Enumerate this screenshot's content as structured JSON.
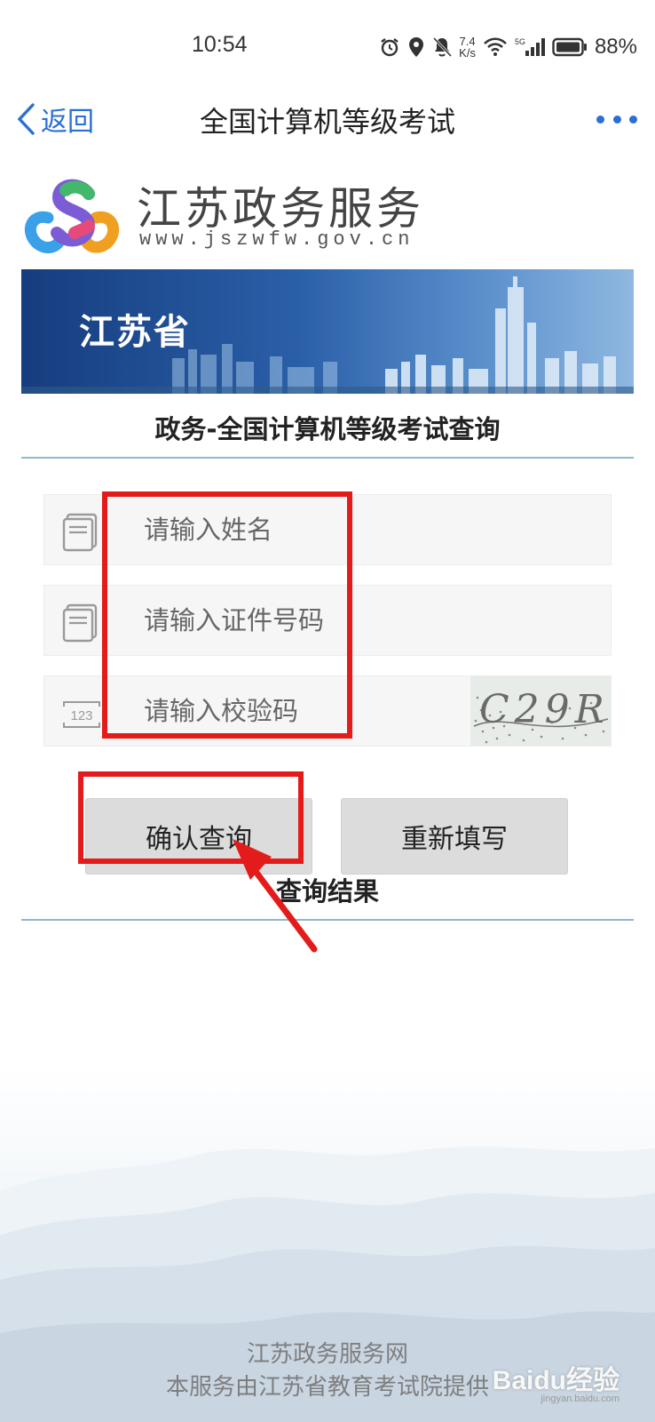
{
  "status_bar": {
    "time": "10:54",
    "speed_value": "7.4",
    "speed_unit": "K/s",
    "network_label": "5G",
    "battery": "88%"
  },
  "nav": {
    "back_label": "返回",
    "title": "全国计算机等级考试"
  },
  "logo": {
    "name": "江苏政务服务",
    "url": "www.jszwfw.gov.cn"
  },
  "banner": {
    "title": "江苏省"
  },
  "form": {
    "heading": "政务-全国计算机等级考试查询",
    "name_placeholder": "请输入姓名",
    "id_placeholder": "请输入证件号码",
    "code_placeholder": "请输入校验码",
    "code_icon_text": "123",
    "captcha_text": "C29R",
    "confirm_label": "确认查询",
    "reset_label": "重新填写"
  },
  "results": {
    "heading": "查询结果"
  },
  "footer": {
    "line1": "江苏政务服务网",
    "line2": "本服务由江苏省教育考试院提供",
    "watermark": "Baidu经验",
    "watermark_url": "jingyan.baidu.com"
  },
  "colors": {
    "accent": "#2a6fd6",
    "annotation": "#e41b1b"
  }
}
